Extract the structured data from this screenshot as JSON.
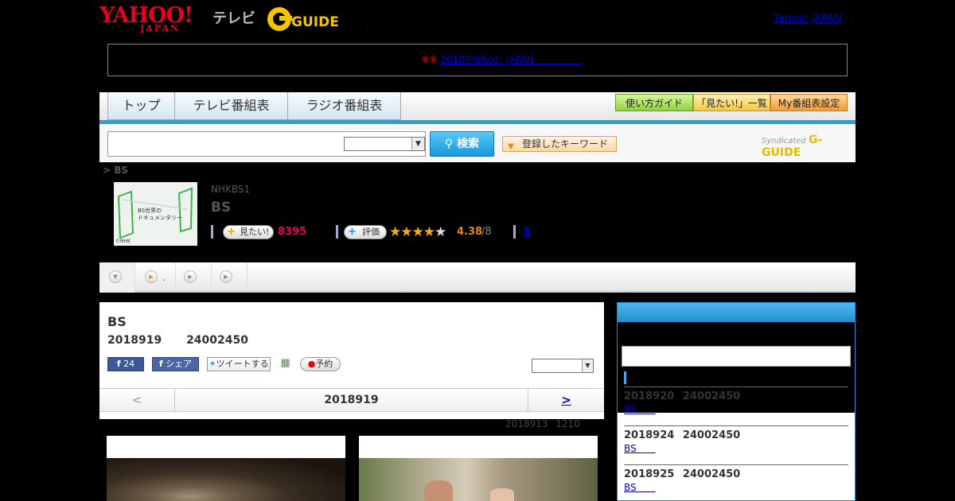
{
  "header": {
    "logo": {
      "main": "YAHOO!",
      "sub": "JAPAN"
    },
    "section_label": "テレビ",
    "gguide": "G-GUIDE",
    "yahoo_link": "Yahoo! JAPAN",
    "dot1": ",",
    "dot2": ","
  },
  "notice": {
    "marks": "※※",
    "link": "20189Yahoo! JAPAN　　　　　"
  },
  "tabs": [
    "トップ",
    "テレビ番組表",
    "ラジオ番組表"
  ],
  "right_buttons": [
    "使い方ガイド",
    "「見たい!」一覧",
    "My番組表設定"
  ],
  "search": {
    "button": "検索",
    "keyword_button": "登録したキーワード",
    "syndicated": "Syndicated"
  },
  "breadcrumb": "> BS",
  "program": {
    "thumb_text": "BS世界の\nドキュメンタリー",
    "thumb_credit": "©NHK",
    "channel": "NHKBS1",
    "title": "BS",
    "mitai_label": "見たい!",
    "mitai_count": "8395",
    "rating_label": "評価",
    "stars": 4.38,
    "rating_value": "4.38",
    "rating_total": "/8",
    "review_count": "8"
  },
  "player": {
    "item2": "."
  },
  "main": {
    "title": "BS",
    "date": "2018919 24002450",
    "fb_like": "24",
    "fb_share": "シェア",
    "tweet": "ツイートする",
    "reserve": "予約",
    "nav_prev": "<",
    "nav_current": "2018919",
    "nav_next": ">",
    "updated": "2018913 1210"
  },
  "sidebar": {
    "items": [
      {
        "date": "2018920 24002450",
        "link": "BS　　"
      },
      {
        "date": "2018924 24002450",
        "link": "BS　　"
      },
      {
        "date": "2018925 24002450",
        "link": "BS　　"
      }
    ]
  },
  "colors": {
    "accent": "#29a0d8",
    "rating": "#e8830c",
    "mitai": "#e6005c"
  }
}
